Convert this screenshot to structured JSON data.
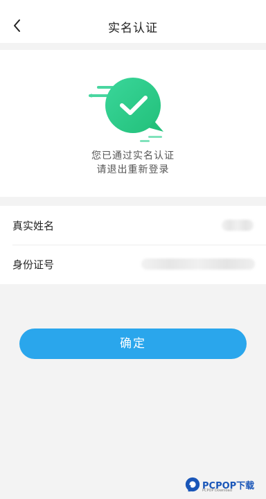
{
  "header": {
    "back_icon": "chevron-left-icon",
    "title": "实名认证"
  },
  "status": {
    "icon": "check-bubble-icon",
    "line1": "您已通过实名认证",
    "line2": "请退出重新登录"
  },
  "info": {
    "rows": [
      {
        "label": "真实姓名",
        "value_blurred": true
      },
      {
        "label": "身份证号",
        "value_blurred": true
      }
    ]
  },
  "actions": {
    "confirm_label": "确定"
  },
  "watermark": {
    "brand": "PCPOP下载",
    "sub": "PCPOP Download"
  },
  "colors": {
    "accent": "#2aa6ec",
    "check_green": "#2fcf8a"
  }
}
